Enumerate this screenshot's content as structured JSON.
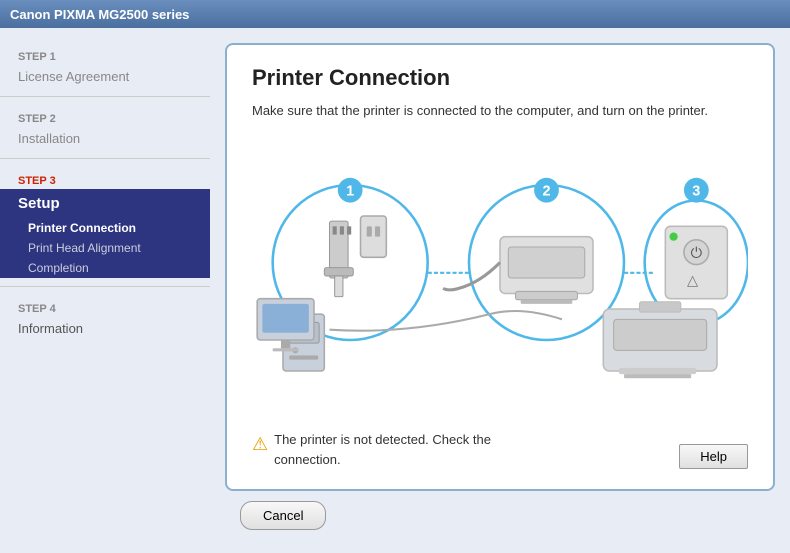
{
  "titleBar": {
    "label": "Canon PIXMA MG2500 series"
  },
  "sidebar": {
    "step1": {
      "label": "STEP 1",
      "item": "License Agreement"
    },
    "step2": {
      "label": "STEP 2",
      "item": "Installation"
    },
    "step3": {
      "label": "STEP 3",
      "parent": "Setup",
      "subItems": [
        "Printer Connection",
        "Print Head Alignment",
        "Completion"
      ]
    },
    "step4": {
      "label": "STEP 4",
      "item": "Information"
    }
  },
  "content": {
    "title": "Printer Connection",
    "description": "Make sure that the printer is connected to the computer, and turn on the printer.",
    "warningText": "The printer is not detected. Check the connection.",
    "helpButton": "Help",
    "cancelButton": "Cancel"
  }
}
